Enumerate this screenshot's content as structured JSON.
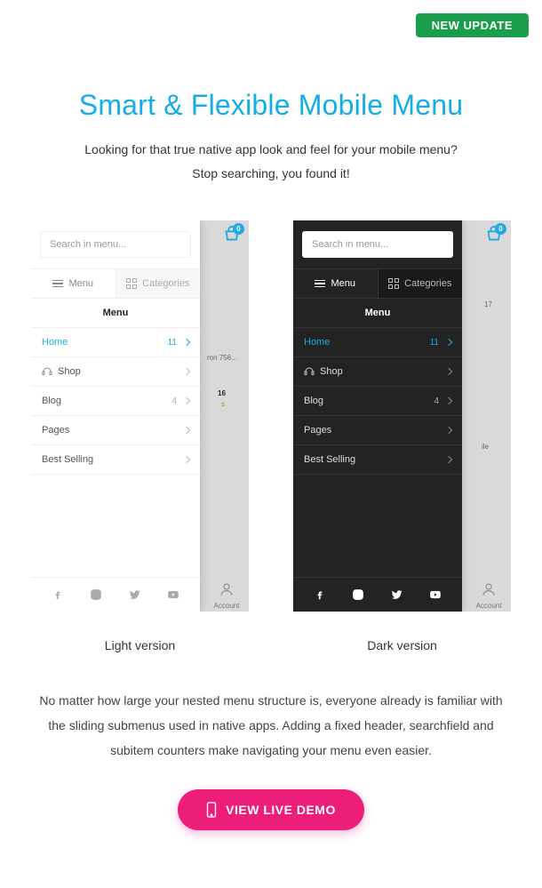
{
  "badge": "NEW UPDATE",
  "title": "Smart & Flexible Mobile Menu",
  "subtitle_1": "Looking for that true native app look and feel for your mobile menu?",
  "subtitle_2": "Stop searching, you found it!",
  "preview": {
    "light_caption": "Light version",
    "dark_caption": "Dark version",
    "search_placeholder": "Search in menu...",
    "tab_menu": "Menu",
    "tab_categories": "Categories",
    "section_title": "Menu",
    "cart_count": "0",
    "account_label": "Account",
    "items": [
      {
        "label": "Home",
        "count": "11",
        "active": true,
        "icon": ""
      },
      {
        "label": "Shop",
        "count": "",
        "active": false,
        "icon": "headset"
      },
      {
        "label": "Blog",
        "count": "4",
        "active": false,
        "icon": ""
      },
      {
        "label": "Pages",
        "count": "",
        "active": false,
        "icon": ""
      },
      {
        "label": "Best Selling",
        "count": "",
        "active": false,
        "icon": ""
      }
    ],
    "bg_snippets": {
      "iron": "ron 756...",
      "sixteen": "16",
      "s": "s",
      "ile": "ile",
      "seventeen": "17"
    }
  },
  "description": "No matter how large your nested menu structure is, everyone already is familiar with the sliding submenus used in native apps. Adding a fixed header, searchfield and subitem counters make navigating your menu even easier.",
  "cta_label": "VIEW LIVE DEMO"
}
